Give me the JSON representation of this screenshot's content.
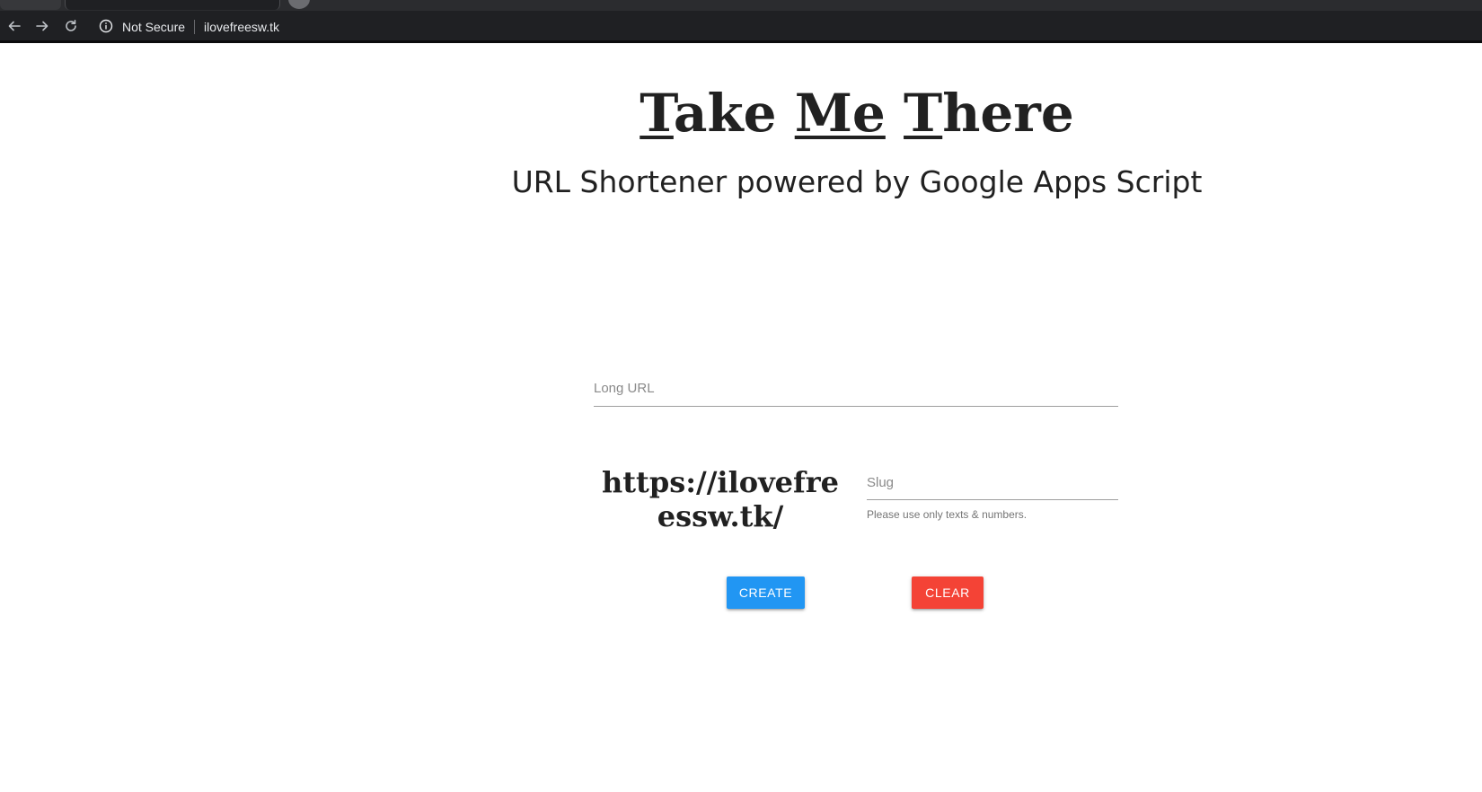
{
  "browser": {
    "security_label": "Not Secure",
    "address": "ilovefreesw.tk"
  },
  "page": {
    "title_words": [
      "Take",
      "Me",
      "There"
    ],
    "subtitle": "URL Shortener powered by Google Apps Script"
  },
  "form": {
    "long_url": {
      "placeholder": "Long URL",
      "value": ""
    },
    "domain_prefix": "https://ilovefreessw.tk/",
    "slug": {
      "placeholder": "Slug",
      "value": ""
    },
    "slug_helper": "Please use only texts & numbers.",
    "create_label": "CREATE",
    "clear_label": "CLEAR"
  },
  "colors": {
    "browser_chrome": "#1f2023",
    "create_button": "#2196f3",
    "clear_button": "#f44336",
    "text": "#212121"
  },
  "icons": {
    "back": "arrow-left-icon",
    "forward": "arrow-right-icon",
    "reload": "reload-icon",
    "info": "info-icon"
  }
}
